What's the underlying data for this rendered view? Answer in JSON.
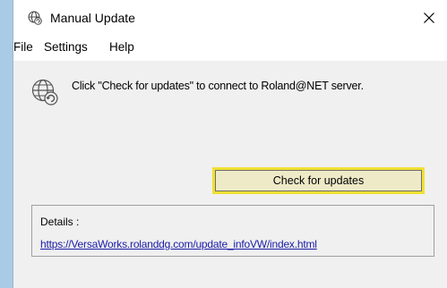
{
  "window": {
    "title": "Manual Update",
    "icons": {
      "app": "globe-refresh-icon",
      "close": "close-icon"
    }
  },
  "menu": {
    "items": [
      "File",
      "Settings",
      "Help"
    ]
  },
  "main": {
    "icon": "globe-refresh-icon",
    "message": "Click \"Check for updates\" to connect to Roland@NET server.",
    "check_button_label": "Check for updates"
  },
  "details": {
    "label": "Details :",
    "link": "https://VersaWorks.rolanddg.com/update_infoVW/index.html"
  },
  "colors": {
    "accent_focus": "#f0e033",
    "button_face": "#eeeac7",
    "link": "#1a1aa8",
    "desktop": "#a9cbe6"
  }
}
